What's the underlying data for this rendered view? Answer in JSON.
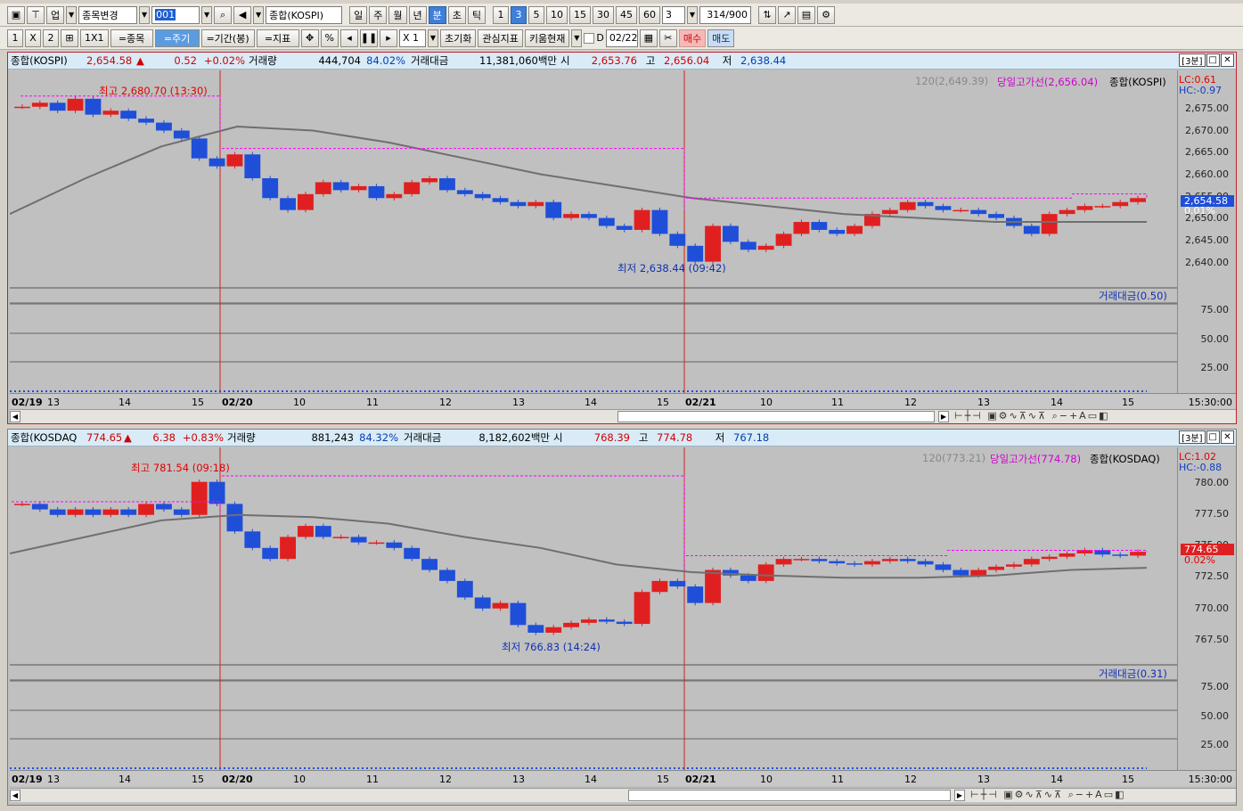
{
  "toolbar1": {
    "market": "업",
    "change_item": "종목변경",
    "code": "001",
    "index_name": "종합(KOSPI)",
    "periods": [
      "일",
      "주",
      "월",
      "년",
      "분",
      "초",
      "틱"
    ],
    "active_period": "분",
    "minutes": [
      "1",
      "3",
      "5",
      "10",
      "15",
      "30",
      "45",
      "60"
    ],
    "active_minute": "3",
    "interval_value": "3",
    "count": "314",
    "count_max": "/900"
  },
  "toolbar2": {
    "layout_1": "1",
    "layout_x": "X",
    "layout_2": "2",
    "layout_1x1": "1X1",
    "item_btn": "=종목",
    "period_btn": "=주기",
    "range_btn": "=기간(봉)",
    "indicator_btn": "=지표",
    "percent": "%",
    "zoom": "X 1",
    "reset": "초기화",
    "watch": "관심지표",
    "kiwoom": "키움현재",
    "d_label": "D",
    "date": "02/22",
    "buy": "매수",
    "sell": "매도"
  },
  "kospi": {
    "name": "종합(KOSPI)",
    "price": "2,654.58",
    "arrow": "▲",
    "change": "0.52",
    "change_pct": "+0.02%",
    "volume_label": "거래량",
    "volume": "444,704",
    "volume_pct": "84.02%",
    "amount_label": "거래대금",
    "amount": "11,381,060백만",
    "open_label": "시",
    "open": "2,653.76",
    "high_label": "고",
    "high": "2,656.04",
    "low_label": "저",
    "low": "2,638.44",
    "tf": "[3분]",
    "legend_ma": "120(2,649.39)",
    "legend_day_high": "당일고가선(2,656.04)",
    "legend_series": "종합(KOSPI)",
    "lc": "LC:0.61",
    "hc": "HC:-0.97",
    "max_label": "최고 2,680.70 (13:30)",
    "min_label": "최저 2,638.44 (09:42)",
    "current_tag": "2,654.58",
    "current_pct": "0.01%",
    "y_ticks": [
      "2,675.00",
      "2,670.00",
      "2,665.00",
      "2,660.00",
      "2,655.00",
      "2,650.00",
      "2,645.00",
      "2,640.00"
    ],
    "vol_legend": "거래대금(0.50)",
    "vol_ticks": [
      "75.00",
      "50.00",
      "25.00"
    ],
    "x_labels": [
      "02/19",
      "13",
      "14",
      "15",
      "02/20",
      "10",
      "11",
      "12",
      "13",
      "14",
      "15",
      "02/21",
      "10",
      "11",
      "12",
      "13",
      "14",
      "15"
    ],
    "x_time": "15:30:00"
  },
  "kosdaq": {
    "name": "종합(KOSDAQ",
    "price": "774.65",
    "arrow": "▲",
    "change": "6.38",
    "change_pct": "+0.83%",
    "volume_label": "거래량",
    "volume": "881,243",
    "volume_pct": "84.32%",
    "amount_label": "거래대금",
    "amount": "8,182,602백만",
    "open_label": "시",
    "open": "768.39",
    "high_label": "고",
    "high": "774.78",
    "low_label": "저",
    "low": "767.18",
    "tf": "[3분]",
    "legend_ma": "120(773.21)",
    "legend_day_high": "당일고가선(774.78)",
    "legend_series": "종합(KOSDAQ)",
    "lc": "LC:1.02",
    "hc": "HC:-0.88",
    "max_label": "최고 781.54 (09:18)",
    "min_label": "최저 766.83 (14:24)",
    "current_tag": "774.65",
    "current_pct": "0.02%",
    "y_ticks": [
      "780.00",
      "777.50",
      "775.00",
      "772.50",
      "770.00",
      "767.50"
    ],
    "vol_legend": "거래대금(0.31)",
    "vol_ticks": [
      "75.00",
      "50.00",
      "25.00"
    ],
    "x_labels": [
      "02/19",
      "13",
      "14",
      "15",
      "02/20",
      "10",
      "11",
      "12",
      "13",
      "14",
      "15",
      "02/21",
      "10",
      "11",
      "12",
      "13",
      "14",
      "15"
    ],
    "x_time": "15:30:00"
  },
  "colors": {
    "up": "#e02020",
    "down": "#1f4fd8",
    "ma": "#6f6f6f",
    "high_line": "#ff00ff",
    "day_sep": "#d02020",
    "info_bg": "#d9ebf7"
  },
  "chart_data": [
    {
      "type": "line",
      "title": "종합(KOSPI)",
      "ylim": [
        2636,
        2684
      ],
      "series": [
        {
          "name": "종합(KOSPI)",
          "values": [
            2678,
            2679,
            2677,
            2680,
            2676,
            2677,
            2675,
            2674,
            2672,
            2670,
            2665,
            2663,
            2666,
            2660,
            2655,
            2652,
            2656,
            2659,
            2657,
            2658,
            2655,
            2656,
            2659,
            2660,
            2657,
            2656,
            2655,
            2654,
            2653,
            2654,
            2650,
            2651,
            2650,
            2648,
            2647,
            2652,
            2646,
            2643,
            2639,
            2648,
            2644,
            2642,
            2643,
            2646,
            2649,
            2647,
            2646,
            2648,
            2651,
            2652,
            2654,
            2653,
            2652,
            2652,
            2651,
            2650,
            2648,
            2646,
            2651,
            2652,
            2653,
            2653,
            2654,
            2655
          ]
        },
        {
          "name": "120",
          "values": [
            2651,
            2660,
            2668,
            2673,
            2672,
            2669,
            2665,
            2661,
            2658,
            2655,
            2653,
            2651,
            2650,
            2649,
            2649,
            2649
          ]
        }
      ]
    },
    {
      "type": "line",
      "title": "종합(KOSDAQ)",
      "ylim": [
        766,
        783
      ],
      "series": [
        {
          "name": "종합(KOSDAQ)",
          "values": [
            779,
            778.5,
            778,
            778.5,
            778,
            778.5,
            778,
            779,
            778.5,
            778,
            781,
            779,
            776.5,
            775,
            774,
            776,
            777,
            776,
            776,
            775.5,
            775.5,
            775,
            774,
            773,
            772,
            770.5,
            769.5,
            770,
            768,
            767.3,
            767.8,
            768.2,
            768.5,
            768.3,
            768.1,
            771,
            772,
            771.5,
            770,
            773,
            772.5,
            772,
            773.5,
            774,
            774,
            773.8,
            773.6,
            773.5,
            773.8,
            774,
            773.8,
            773.5,
            773,
            772.5,
            773,
            773.3,
            773.5,
            774,
            774.2,
            774.5,
            774.8,
            774.4,
            774.3,
            774.65
          ]
        },
        {
          "name": "120",
          "values": [
            774.5,
            776,
            777.5,
            778,
            777.8,
            777.2,
            776,
            775,
            773.5,
            772.8,
            772.5,
            772.3,
            772.3,
            772.5,
            773,
            773.2
          ]
        }
      ]
    }
  ]
}
